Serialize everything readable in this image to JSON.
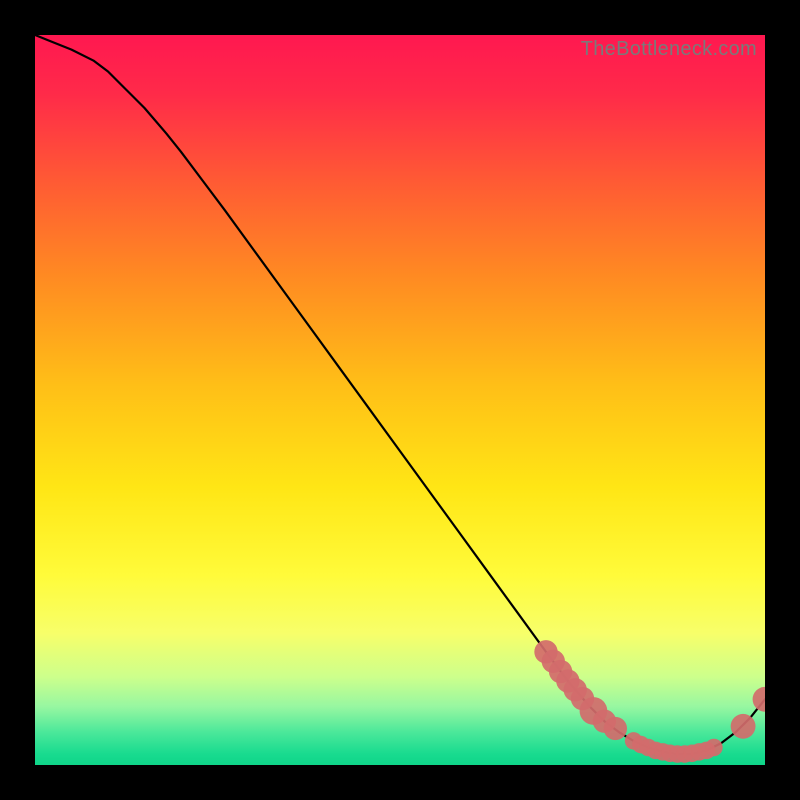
{
  "watermark": "TheBottleneck.com",
  "chart_data": {
    "type": "line",
    "title": "",
    "xlabel": "",
    "ylabel": "",
    "xlim": [
      0,
      100
    ],
    "ylim": [
      0,
      100
    ],
    "curve": {
      "name": "bottleneck-curve",
      "x": [
        0,
        2,
        5,
        8,
        10,
        12,
        15,
        18,
        20,
        23,
        26,
        30,
        34,
        38,
        42,
        46,
        50,
        54,
        58,
        62,
        66,
        70,
        73,
        76,
        78,
        80,
        82,
        84,
        86,
        88,
        90,
        92,
        94,
        96,
        98,
        100
      ],
      "y": [
        100,
        99.2,
        98,
        96.5,
        95,
        93,
        90,
        86.5,
        84,
        80,
        76,
        70.5,
        65,
        59.5,
        54,
        48.5,
        43,
        37.5,
        32,
        26.5,
        21,
        15.5,
        11.5,
        8,
        6,
        4.5,
        3.3,
        2.4,
        1.8,
        1.5,
        1.5,
        2,
        3,
        4.5,
        6.5,
        9
      ]
    },
    "markers": {
      "name": "highlight-points",
      "color": "#d26b6b",
      "points": [
        {
          "x": 70,
          "y": 15.5,
          "r": 1.6
        },
        {
          "x": 71,
          "y": 14.2,
          "r": 1.6
        },
        {
          "x": 72,
          "y": 12.8,
          "r": 1.6
        },
        {
          "x": 73,
          "y": 11.5,
          "r": 1.6
        },
        {
          "x": 74,
          "y": 10.3,
          "r": 1.6
        },
        {
          "x": 75,
          "y": 9.1,
          "r": 1.6
        },
        {
          "x": 76.5,
          "y": 7.4,
          "r": 1.9
        },
        {
          "x": 78,
          "y": 6,
          "r": 1.6
        },
        {
          "x": 79.5,
          "y": 5,
          "r": 1.6
        },
        {
          "x": 82,
          "y": 3.3,
          "r": 1.2
        },
        {
          "x": 83,
          "y": 2.8,
          "r": 1.2
        },
        {
          "x": 84,
          "y": 2.4,
          "r": 1.2
        },
        {
          "x": 85,
          "y": 2,
          "r": 1.2
        },
        {
          "x": 86,
          "y": 1.8,
          "r": 1.2
        },
        {
          "x": 87,
          "y": 1.6,
          "r": 1.2
        },
        {
          "x": 88,
          "y": 1.5,
          "r": 1.2
        },
        {
          "x": 89,
          "y": 1.5,
          "r": 1.2
        },
        {
          "x": 90,
          "y": 1.6,
          "r": 1.2
        },
        {
          "x": 91,
          "y": 1.8,
          "r": 1.2
        },
        {
          "x": 92,
          "y": 2,
          "r": 1.2
        },
        {
          "x": 93,
          "y": 2.4,
          "r": 1.2
        },
        {
          "x": 97,
          "y": 5.3,
          "r": 1.7
        },
        {
          "x": 100,
          "y": 9,
          "r": 1.7
        }
      ]
    },
    "gradient_stops": [
      {
        "pos": 0,
        "color": "#ff1850"
      },
      {
        "pos": 0.08,
        "color": "#ff2a49"
      },
      {
        "pos": 0.2,
        "color": "#ff5a34"
      },
      {
        "pos": 0.33,
        "color": "#ff8a22"
      },
      {
        "pos": 0.48,
        "color": "#ffbf17"
      },
      {
        "pos": 0.62,
        "color": "#ffe615"
      },
      {
        "pos": 0.74,
        "color": "#fffb3a"
      },
      {
        "pos": 0.82,
        "color": "#f7ff6a"
      },
      {
        "pos": 0.88,
        "color": "#ccff8c"
      },
      {
        "pos": 0.92,
        "color": "#97f7a1"
      },
      {
        "pos": 0.955,
        "color": "#4be89a"
      },
      {
        "pos": 0.985,
        "color": "#18db8f"
      },
      {
        "pos": 1.0,
        "color": "#0fd589"
      }
    ]
  }
}
